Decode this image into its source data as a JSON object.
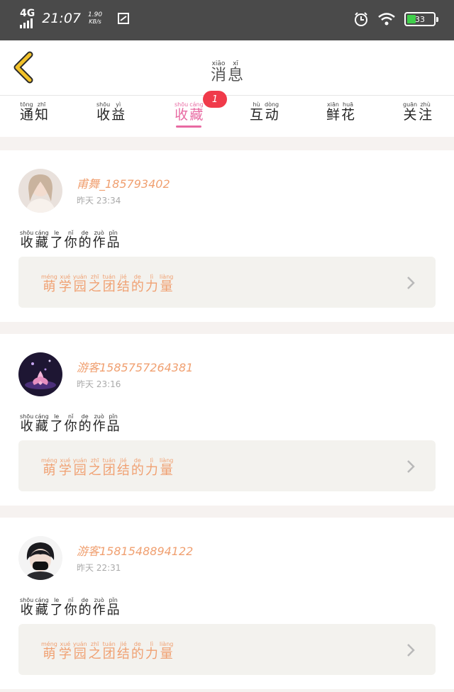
{
  "status_bar": {
    "network": "4G",
    "time": "21:07",
    "speed_value": "1.90",
    "speed_unit": "KB/s",
    "battery": "33",
    "colors": {
      "battery_fill": "#3fcf4a"
    }
  },
  "header": {
    "back_icon": "chevron-left-icon",
    "title": [
      {
        "py": "xiāo",
        "hz": "消"
      },
      {
        "py": "xī",
        "hz": "息"
      }
    ]
  },
  "tabs": [
    {
      "chars": [
        {
          "py": "tōng",
          "hz": "通"
        },
        {
          "py": "zhī",
          "hz": "知"
        }
      ]
    },
    {
      "chars": [
        {
          "py": "shōu",
          "hz": "收"
        },
        {
          "py": "yì",
          "hz": "益"
        }
      ]
    },
    {
      "chars": [
        {
          "py": "shōu",
          "hz": "收"
        },
        {
          "py": "cáng",
          "hz": "藏"
        }
      ],
      "active": true,
      "badge": "1"
    },
    {
      "chars": [
        {
          "py": "hù",
          "hz": "互"
        },
        {
          "py": "dòng",
          "hz": "动"
        }
      ]
    },
    {
      "chars": [
        {
          "py": "xiān",
          "hz": "鲜"
        },
        {
          "py": "huā",
          "hz": "花"
        }
      ]
    },
    {
      "chars": [
        {
          "py": "guān",
          "hz": "关"
        },
        {
          "py": "zhù",
          "hz": "注"
        }
      ]
    }
  ],
  "action_text": [
    {
      "py": "shōu",
      "hz": "收"
    },
    {
      "py": "cáng",
      "hz": "藏"
    },
    {
      "py": "le",
      "hz": "了"
    },
    {
      "py": "nǐ",
      "hz": "你"
    },
    {
      "py": "de",
      "hz": "的"
    },
    {
      "py": "zuò",
      "hz": "作"
    },
    {
      "py": "pǐn",
      "hz": "品"
    }
  ],
  "work_title": [
    {
      "py": "méng",
      "hz": "萌"
    },
    {
      "py": "xué",
      "hz": "学"
    },
    {
      "py": "yuán",
      "hz": "园"
    },
    {
      "py": "zhī",
      "hz": "之"
    },
    {
      "py": "tuán",
      "hz": "团"
    },
    {
      "py": "jié",
      "hz": "结"
    },
    {
      "py": "de",
      "hz": "的"
    },
    {
      "py": "lì",
      "hz": "力"
    },
    {
      "py": "liàng",
      "hz": "量"
    }
  ],
  "notifications": [
    {
      "username": "甫舞_185793402",
      "time": "昨天 23:34"
    },
    {
      "username": "游客1585757264381",
      "time": "昨天 23:16"
    },
    {
      "username": "游客1581548894122",
      "time": "昨天 22:31"
    }
  ],
  "colors": {
    "accent_pink": "#e86aa2",
    "accent_orange": "#f0a071",
    "badge_red": "#f03a4a",
    "back_yellow": "#f2c22a"
  }
}
